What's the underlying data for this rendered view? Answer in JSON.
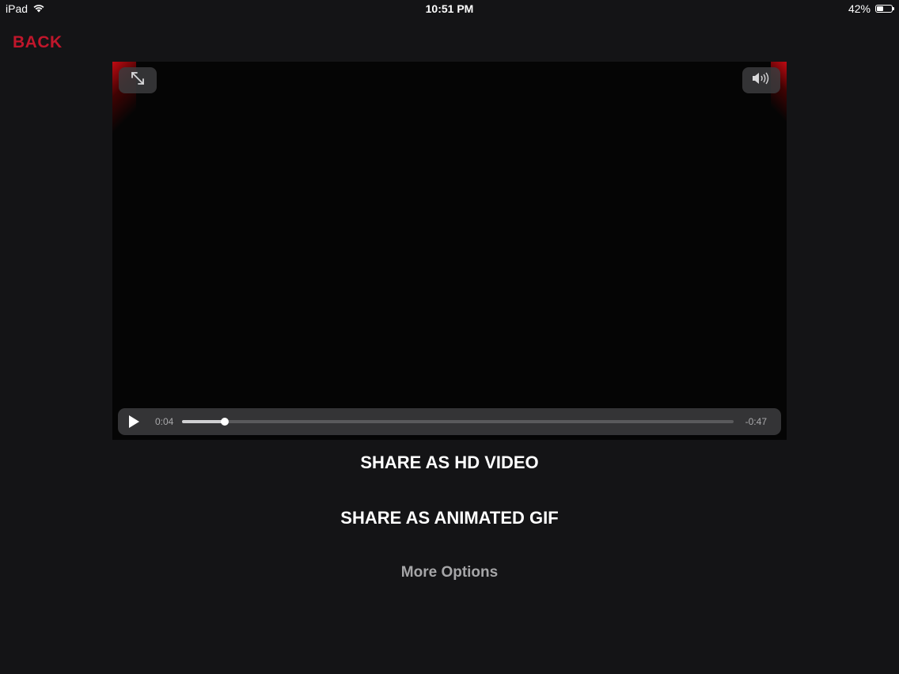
{
  "status_bar": {
    "device": "iPad",
    "time": "10:51 PM",
    "battery": "42%",
    "battery_level": 0.42
  },
  "nav": {
    "back_label": "BACK",
    "accent_color": "#c0162b"
  },
  "player": {
    "current_time": "0:04",
    "remaining_time": "-0:47",
    "progress": 0.078,
    "icons": {
      "fullscreen": "expand-arrows-icon",
      "volume": "speaker-volume-icon",
      "play": "play-icon"
    }
  },
  "actions": {
    "share_hd": "SHARE AS HD VIDEO",
    "share_gif": "SHARE AS ANIMATED GIF",
    "more_options": "More Options"
  }
}
